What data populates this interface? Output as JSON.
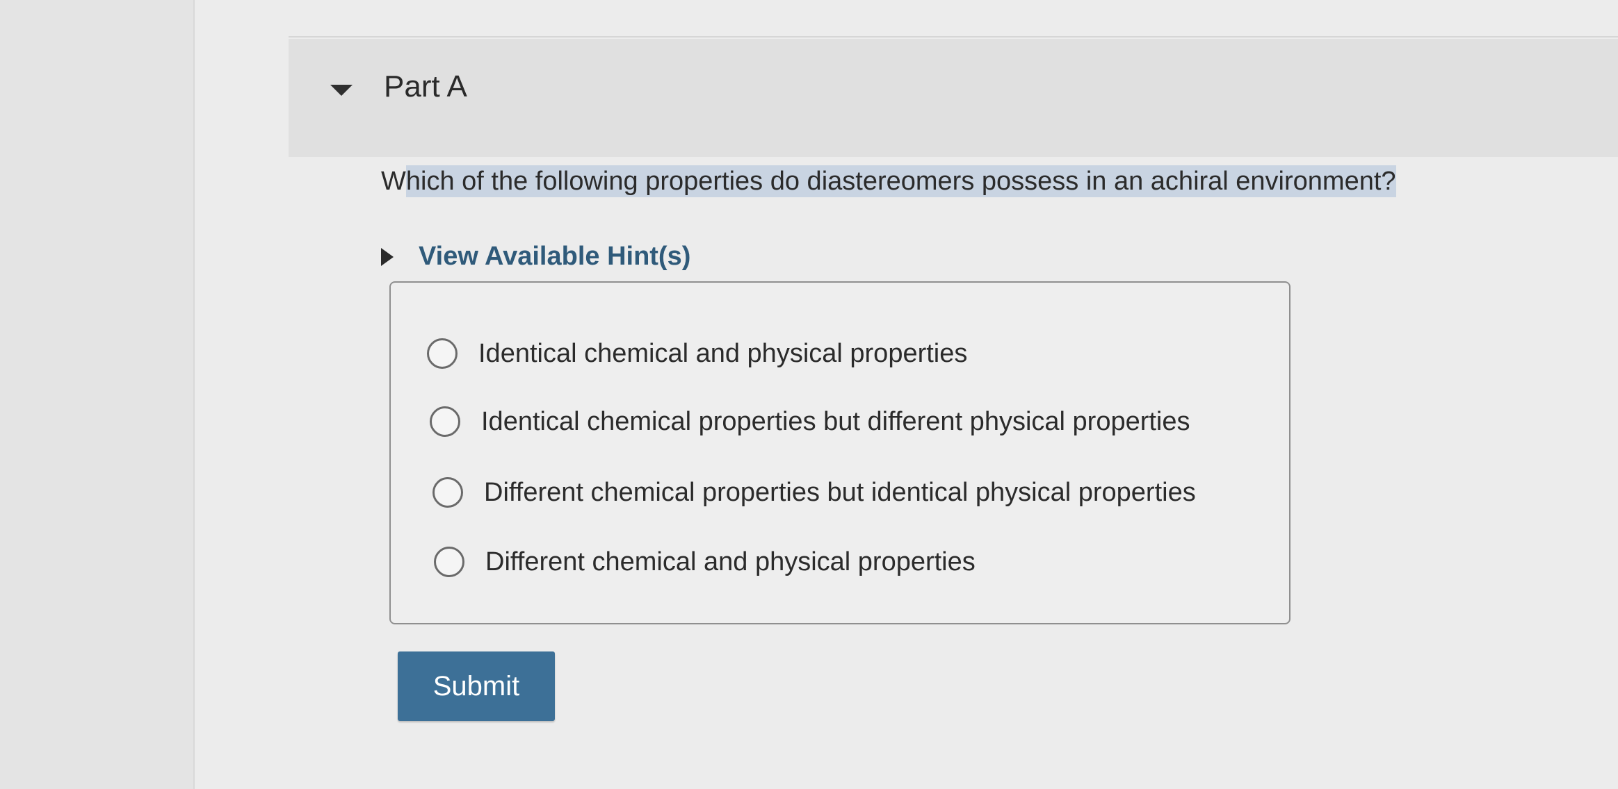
{
  "part": {
    "title": "Part A",
    "toggle_icon": "caret-down-icon"
  },
  "question": {
    "prefix": "W",
    "highlighted_text": "hich of the following properties do diastereomers possess in an achiral environment?",
    "highlight_color": "#c9d4e2"
  },
  "hint": {
    "label": "View Available Hint(s)",
    "icon": "caret-right-icon",
    "color": "#2f5a7a"
  },
  "options": [
    {
      "label": "Identical chemical and physical properties",
      "selected": false
    },
    {
      "label": "Identical chemical properties but different physical properties",
      "selected": false
    },
    {
      "label": "Different chemical properties but identical physical properties",
      "selected": false
    },
    {
      "label": "Different chemical and physical properties",
      "selected": false
    }
  ],
  "submit": {
    "label": "Submit",
    "color": "#3d7097"
  }
}
